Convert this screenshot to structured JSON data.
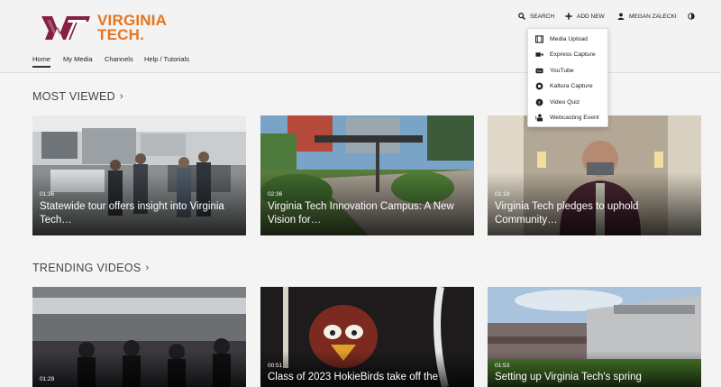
{
  "brand": {
    "name_line1": "VIRGINIA",
    "name_line2": "TECH.",
    "mark_color": "#861f41",
    "accent_color": "#e5751f"
  },
  "nav": {
    "items": [
      "Home",
      "My Media",
      "Channels",
      "Help / Tutorials"
    ],
    "active": "Home"
  },
  "topbar": {
    "search": "SEARCH",
    "add_new": "ADD NEW",
    "user": "MEGAN ZALECKI"
  },
  "add_new_menu": [
    "Media Upload",
    "Express Capture",
    "YouTube",
    "Kaltura Capture",
    "Video Quiz",
    "Webcasting Event"
  ],
  "sections": {
    "most_viewed": {
      "title": "MOST VIEWED",
      "cards": [
        {
          "duration": "01:36",
          "title": "Statewide tour offers insight into Virginia Tech…"
        },
        {
          "duration": "02:36",
          "title": "Virginia Tech Innovation Campus: A New Vision for…"
        },
        {
          "duration": "01:19",
          "title": "Virginia Tech pledges to uphold Community…"
        }
      ]
    },
    "trending": {
      "title": "TRENDING VIDEOS",
      "cards": [
        {
          "duration": "01:29",
          "title": ""
        },
        {
          "duration": "00:51",
          "title": "Class of 2023 HokieBirds take off the"
        },
        {
          "duration": "01:53",
          "title": "Setting up Virginia Tech's spring"
        }
      ]
    }
  }
}
